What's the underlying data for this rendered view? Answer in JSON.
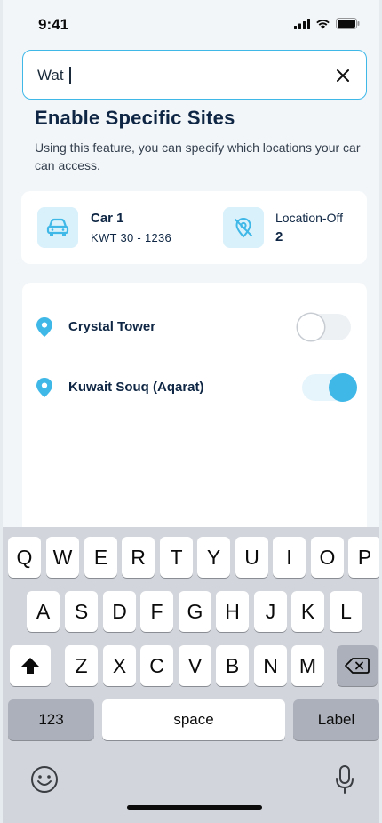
{
  "status_bar": {
    "time": "9:41"
  },
  "search": {
    "value": "Wat"
  },
  "page": {
    "title": "Enable Specific Sites",
    "description": "Using this feature, you can specify which locations your car can access."
  },
  "car": {
    "name": "Car 1",
    "plate": "KWT  30 - 1236",
    "location_label": "Location-Off",
    "location_count": "2"
  },
  "sites": [
    {
      "name": "Crystal Tower",
      "enabled": false
    },
    {
      "name": "Kuwait Souq (Aqarat)",
      "enabled": true
    }
  ],
  "colors": {
    "accent": "#3fb8e8",
    "navy": "#0f2744",
    "tile": "#d9f1fb"
  },
  "keyboard": {
    "row1": [
      "Q",
      "W",
      "E",
      "R",
      "T",
      "Y",
      "U",
      "I",
      "O",
      "P"
    ],
    "row2": [
      "A",
      "S",
      "D",
      "F",
      "G",
      "H",
      "J",
      "K",
      "L"
    ],
    "row3": [
      "Z",
      "X",
      "C",
      "V",
      "B",
      "N",
      "M"
    ],
    "numbers_label": "123",
    "space_label": "space",
    "return_label": "Label"
  }
}
